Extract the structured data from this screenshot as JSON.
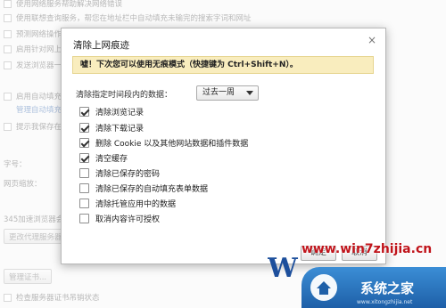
{
  "background": {
    "rows": [
      {
        "text": "使用网络服务帮助解决网络错误",
        "checked": false
      },
      {
        "text": "使用联想查询服务，帮您在地址栏中自动填充未输完的搜索字词和网址",
        "checked": false
      },
      {
        "text": "预测网络操作，以便更快地加载网页",
        "checked": false
      },
      {
        "text": "启用针对网上诱骗和恶意软件的防护功能",
        "checked": false
      },
      {
        "text": "发送浏览器一般使用情况统计信息",
        "checked": false
      },
      {
        "text": "启用自动填充功能",
        "checked": false
      },
      {
        "text": "提示我保存在网页上输入的密码",
        "checked": false
      }
    ],
    "autofill_link": "管理自动填充设置...",
    "zoom_heading": "字号：",
    "zoom_label": "网页缩放：",
    "proxy_text": "345加速浏览器会使用您计算机的系统代理设置连接到网络。",
    "proxy_button": "更改代理服务器设置...",
    "cert_button": "管理证书...",
    "cert_check_label": "检查服务器证书吊销状态"
  },
  "dialog": {
    "title": "清除上网痕迹",
    "close_glyph": "×",
    "notice": "嘘！下次您可以使用无痕模式（快捷键为 Ctrl+Shift+N）。",
    "range_label": "清除指定时间段内的数据：",
    "range_value": "过去一周",
    "options": [
      {
        "label": "清除浏览记录",
        "checked": true
      },
      {
        "label": "清除下载记录",
        "checked": true
      },
      {
        "label": "删除 Cookie 以及其他网站数据和插件数据",
        "checked": true
      },
      {
        "label": "清空缓存",
        "checked": true
      },
      {
        "label": "清除已保存的密码",
        "checked": false
      },
      {
        "label": "清除已保存的自动填充表单数据",
        "checked": false
      },
      {
        "label": "清除托管应用中的数据",
        "checked": false
      },
      {
        "label": "取消内容许可授权",
        "checked": false
      }
    ],
    "confirm_label": "确定",
    "cancel_label": "取消"
  },
  "watermark": {
    "url": "www.win7zhijia.cn",
    "logo_text": "W",
    "badge_text": "系统之家",
    "badge_sub": "www.xitongzhijia.net"
  },
  "colors": {
    "notice_bg": "#f9edbe",
    "watermark_red": "#c0141b",
    "badge_blue": "#1e5fa8"
  }
}
